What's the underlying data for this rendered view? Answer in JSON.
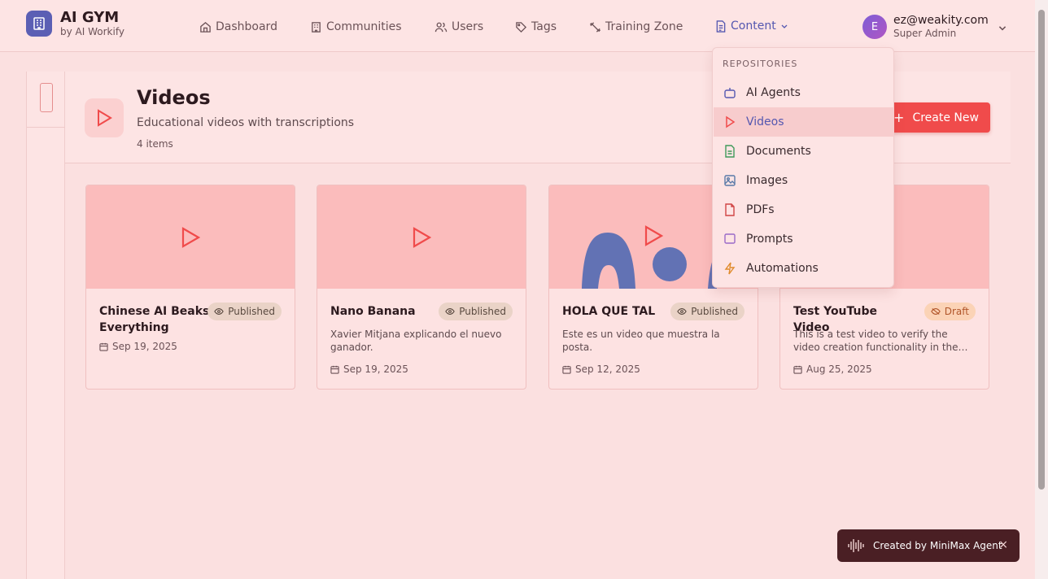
{
  "brand": {
    "title": "AI GYM",
    "subtitle": "by AI Workify"
  },
  "nav": {
    "dashboard": "Dashboard",
    "communities": "Communities",
    "users": "Users",
    "tags": "Tags",
    "training_zone": "Training Zone",
    "content": "Content"
  },
  "user": {
    "initial": "E",
    "email": "ez@weakity.com",
    "role": "Super Admin"
  },
  "page": {
    "title": "Videos",
    "subtitle": "Educational videos with transcriptions",
    "count": "4 items",
    "create_label": "Create New"
  },
  "dropdown": {
    "heading": "REPOSITORIES",
    "items": [
      {
        "label": "AI Agents",
        "icon": "bot-icon"
      },
      {
        "label": "Videos",
        "icon": "play-icon"
      },
      {
        "label": "Documents",
        "icon": "document-icon"
      },
      {
        "label": "Images",
        "icon": "image-icon"
      },
      {
        "label": "PDFs",
        "icon": "pdf-icon"
      },
      {
        "label": "Prompts",
        "icon": "prompt-icon"
      },
      {
        "label": "Automations",
        "icon": "lightning-icon"
      }
    ]
  },
  "cards": [
    {
      "title": "Chinese AI Beaks Everything",
      "status": "Published",
      "description": "",
      "date": "Sep 19, 2025"
    },
    {
      "title": "Nano Banana",
      "status": "Published",
      "description": "Xavier Mitjana explicando el nuevo ganador.",
      "date": "Sep 19, 2025"
    },
    {
      "title": "HOLA QUE TAL",
      "status": "Published",
      "description": "Este es un video que muestra la posta.",
      "date": "Sep 12, 2025"
    },
    {
      "title": "Test YouTube Video",
      "status": "Draft",
      "description": "This is a test video to verify the video creation functionality in the Videos repository.",
      "date": "Aug 25, 2025"
    }
  ],
  "toast": {
    "text": "Created by MiniMax Agent",
    "close": "×"
  },
  "colors": {
    "accent": "#f04b4b",
    "brand": "#5b5fb4",
    "active": "#5457b0"
  }
}
